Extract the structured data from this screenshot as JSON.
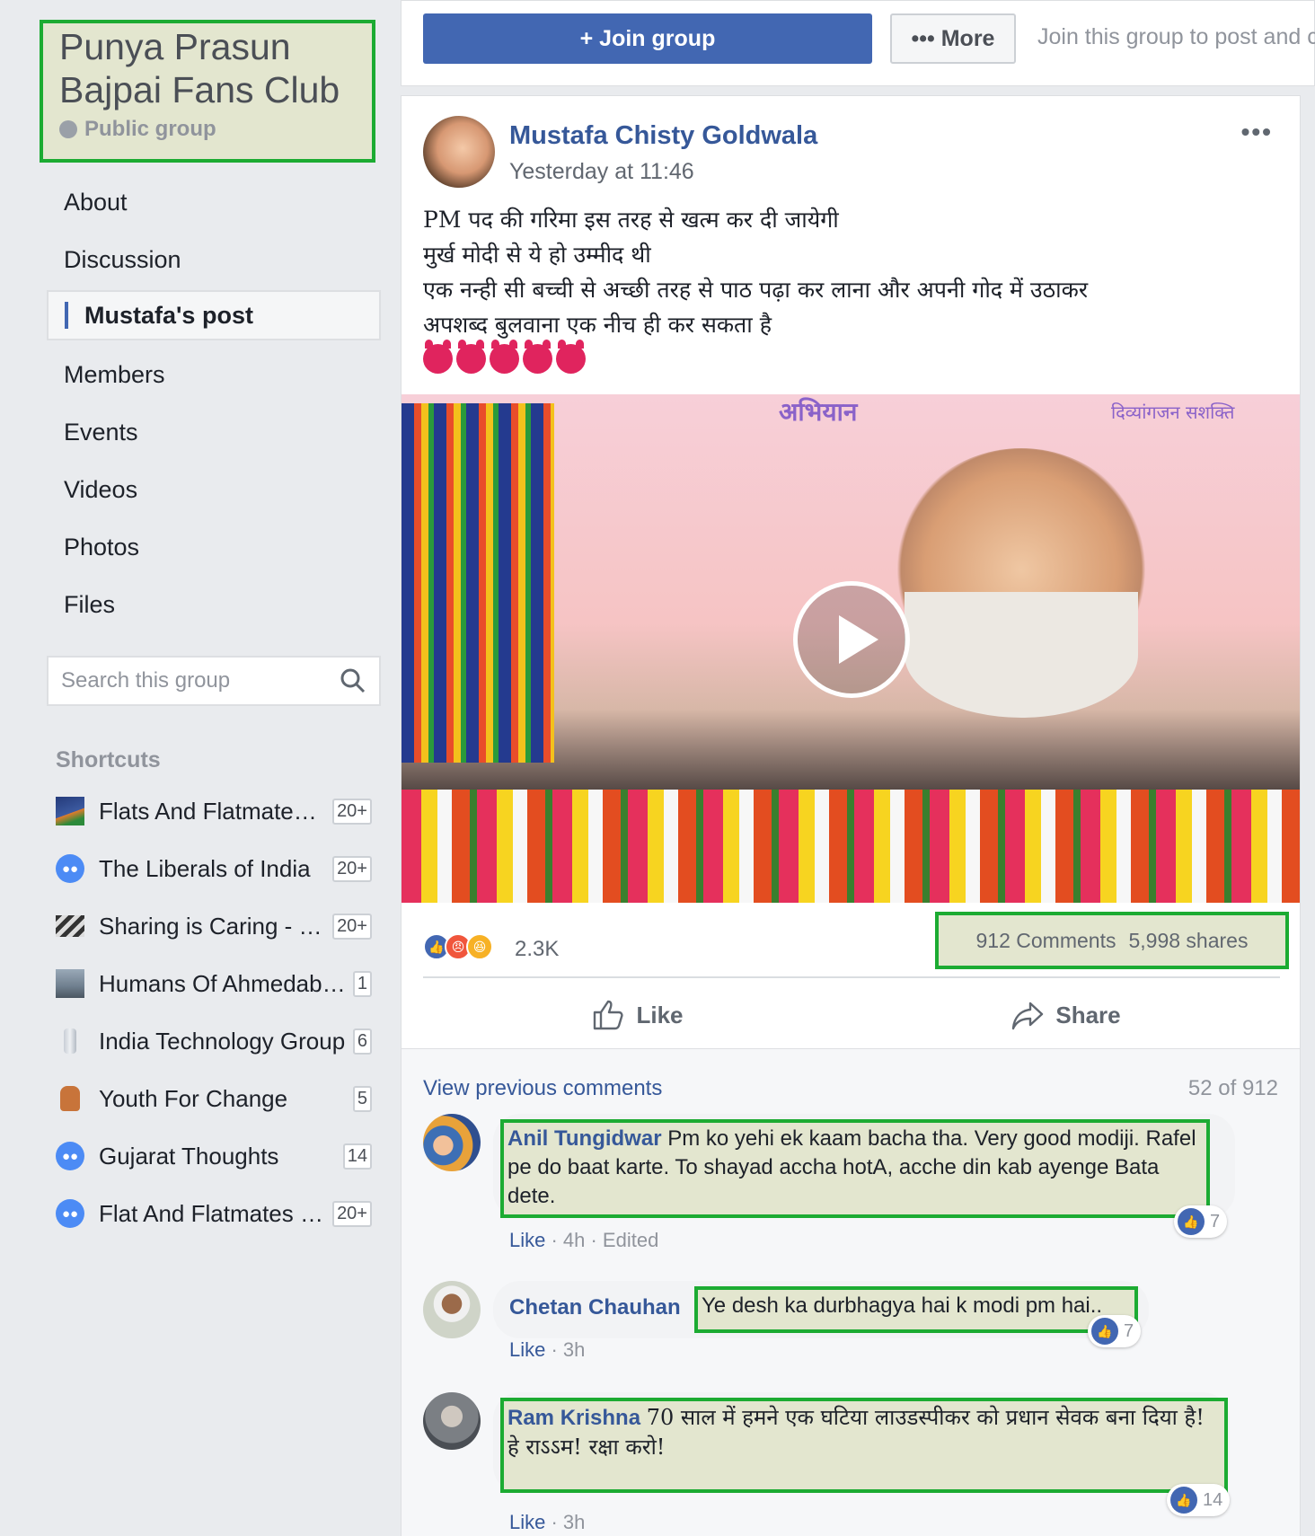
{
  "group": {
    "name": "Punya Prasun Bajpai Fans Club",
    "privacy": "Public group",
    "privacy_icon": "globe-icon"
  },
  "nav": [
    {
      "label": "About"
    },
    {
      "label": "Discussion"
    },
    {
      "label": "Mustafa's post",
      "active": true
    },
    {
      "label": "Members"
    },
    {
      "label": "Events"
    },
    {
      "label": "Videos"
    },
    {
      "label": "Photos"
    },
    {
      "label": "Files"
    }
  ],
  "search": {
    "placeholder": "Search this group",
    "icon": "search-icon"
  },
  "shortcuts": {
    "heading": "Shortcuts",
    "items": [
      {
        "label": "Flats And Flatmate…",
        "count": "20+",
        "icon": "camping-photo"
      },
      {
        "label": "The Liberals of India",
        "count": "20+",
        "icon": "group-icon"
      },
      {
        "label": "Sharing is Caring - …",
        "count": "20+",
        "icon": "clapperboard-icon"
      },
      {
        "label": "Humans Of Ahmedab…",
        "count": "1",
        "icon": "landscape-photo"
      },
      {
        "label": "India Technology Group",
        "count": "6",
        "icon": "bottle-photo"
      },
      {
        "label": "Youth For Change",
        "count": "5",
        "icon": "fist-photo"
      },
      {
        "label": "Gujarat Thoughts",
        "count": "14",
        "icon": "group-icon"
      },
      {
        "label": "Flat And Flatmates …",
        "count": "20+",
        "icon": "group-icon"
      }
    ]
  },
  "topbar": {
    "join_label": "+ Join group",
    "more_label": "••• More",
    "join_text": "Join this group to post and co"
  },
  "post": {
    "author": "Mustafa Chisty Goldwala",
    "time": "Yesterday at 11:46",
    "text_lines": [
      "PM पद की गरिमा इस तरह से खत्म कर दी जायेगी",
      "मुर्ख मोदी से ये हो उम्मीद थी",
      "एक नन्ही सी बच्ची से अच्छी तरह से पाठ पढ़ा कर लाना और अपनी गोद में उठाकर",
      "अपशब्द बुलवाना एक नीच ही कर सकता है"
    ],
    "emojis": [
      "devil-emoji",
      "devil-emoji",
      "devil-emoji",
      "devil-emoji",
      "devil-emoji"
    ],
    "video": {
      "banner_text": "अभियान",
      "banner_right": "दिव्यांगजन सशक्ति"
    },
    "reactions": {
      "count": "2.3K",
      "comments": "912 Comments",
      "shares": "5,998 shares"
    },
    "actions": {
      "like": "Like",
      "share": "Share"
    }
  },
  "comments": {
    "view_previous": "View previous comments",
    "count": "52 of 912",
    "list": [
      {
        "name": "Anil Tungidwar",
        "text": "Pm ko yehi ek kaam bacha tha. Very good modiji. Rafel pe do baat karte. To shayad accha hotA, acche din kab ayenge Bata dete.",
        "like": "Like",
        "meta": " · 4h · Edited",
        "reactions": "7"
      },
      {
        "name": "Chetan Chauhan",
        "text": "Ye desh ka durbhagya hai k modi pm hai..",
        "like": "Like",
        "meta": " · 3h",
        "reactions": "7"
      },
      {
        "name": "Ram Krishna",
        "text": "70 साल में हमने एक घटिया लाउडस्पीकर को प्रधान सेवक बना दिया है!",
        "text2": "हे राऽऽम! रक्षा करो!",
        "like": "Like",
        "meta": " · 3h",
        "reactions": "14"
      }
    ]
  },
  "colors": {
    "accent": "#4267b2",
    "link": "#365899",
    "highlight_border": "#1cab32",
    "highlight_fill": "#e3e6cf"
  }
}
